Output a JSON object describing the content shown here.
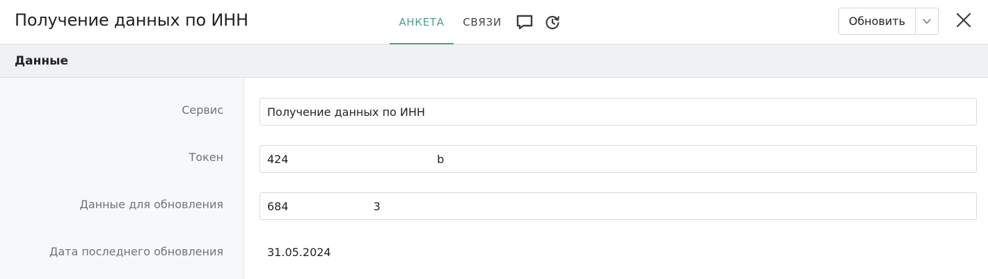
{
  "header": {
    "title": "Получение данных по ИНН",
    "tabs": [
      {
        "label": "АНКЕТА",
        "active": true
      },
      {
        "label": "СВЯЗИ",
        "active": false
      }
    ],
    "icons": [
      "comment-icon",
      "history-icon"
    ],
    "update_button": "Обновить",
    "accent_color": "#4f9e8d"
  },
  "section": {
    "title": "Данные"
  },
  "fields": [
    {
      "label": "Сервис",
      "value": "Получение данных по ИНН",
      "editable": true
    },
    {
      "label": "Токен",
      "value": "424                                          b",
      "editable": true
    },
    {
      "label": "Данные для обновления",
      "value": "684                        3",
      "editable": true
    },
    {
      "label": "Дата последнего обновления",
      "value": "31.05.2024",
      "editable": false
    }
  ]
}
